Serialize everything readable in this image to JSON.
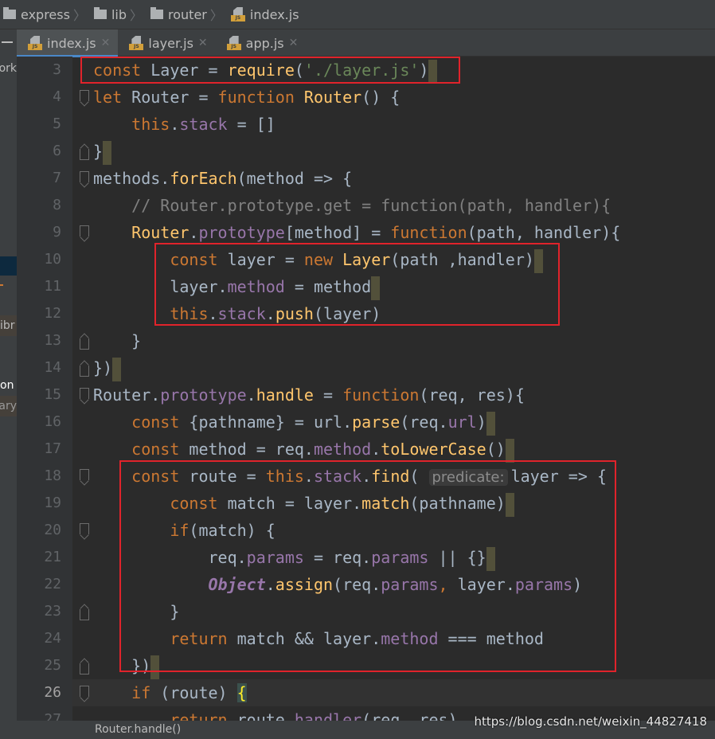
{
  "breadcrumb": [
    "express",
    "lib",
    "router",
    "index.js"
  ],
  "tabs": [
    {
      "label": "index.js",
      "active": true
    },
    {
      "label": "layer.js",
      "active": false
    },
    {
      "label": "app.js",
      "active": false
    }
  ],
  "left_panel_fragments": [
    "ork",
    "ibr",
    "on",
    "ary"
  ],
  "code_lines": [
    {
      "n": 3,
      "tokens": [
        [
          "const ",
          "kw"
        ],
        [
          "Layer = ",
          ""
        ],
        [
          "require",
          "fn"
        ],
        [
          "(",
          ""
        ],
        [
          "'./layer.js'",
          "st"
        ],
        [
          ")",
          ""
        ]
      ],
      "eol": true
    },
    {
      "n": 4,
      "fold": "start",
      "tokens": [
        [
          "let ",
          "kw"
        ],
        [
          "Router = ",
          ""
        ],
        [
          "function ",
          "kw"
        ],
        [
          "Router",
          "fn"
        ],
        [
          "() {",
          ""
        ]
      ]
    },
    {
      "n": 5,
      "tokens": [
        [
          "    ",
          ""
        ],
        [
          "this",
          "kw"
        ],
        [
          ".",
          ""
        ],
        [
          "stack",
          "pr"
        ],
        [
          " = []",
          ""
        ]
      ]
    },
    {
      "n": 6,
      "fold": "end",
      "tokens": [
        [
          "}",
          ""
        ]
      ],
      "eol": true
    },
    {
      "n": 7,
      "fold": "start",
      "tokens": [
        [
          "methods",
          ""
        ],
        [
          ".",
          ""
        ],
        [
          "forEach",
          "fn"
        ],
        [
          "(method => {",
          ""
        ]
      ]
    },
    {
      "n": 8,
      "tokens": [
        [
          "    // Router.prototype.get = function(path, handler){",
          "cm"
        ]
      ]
    },
    {
      "n": 9,
      "fold": "start",
      "tokens": [
        [
          "    ",
          ""
        ],
        [
          "Router",
          "fn"
        ],
        [
          ".",
          ""
        ],
        [
          "prototype",
          "pr"
        ],
        [
          "[method] = ",
          ""
        ],
        [
          "function",
          "kw"
        ],
        [
          "(path, handler){",
          ""
        ]
      ]
    },
    {
      "n": 10,
      "tokens": [
        [
          "        ",
          ""
        ],
        [
          "const ",
          "kw"
        ],
        [
          "layer = ",
          ""
        ],
        [
          "new ",
          "kw"
        ],
        [
          "Layer",
          "fn"
        ],
        [
          "(path ,handler)",
          ""
        ]
      ],
      "eol": true
    },
    {
      "n": 11,
      "tokens": [
        [
          "        layer.",
          ""
        ],
        [
          "method",
          "pr"
        ],
        [
          " = method",
          ""
        ]
      ],
      "eol": true
    },
    {
      "n": 12,
      "tokens": [
        [
          "        ",
          ""
        ],
        [
          "this",
          "kw"
        ],
        [
          ".",
          ""
        ],
        [
          "stack",
          "pr"
        ],
        [
          ".",
          ""
        ],
        [
          "push",
          "fn"
        ],
        [
          "(layer)",
          ""
        ]
      ]
    },
    {
      "n": 13,
      "fold": "end",
      "tokens": [
        [
          "    }",
          ""
        ]
      ]
    },
    {
      "n": 14,
      "fold": "end",
      "tokens": [
        [
          "})",
          ""
        ]
      ],
      "eol": true
    },
    {
      "n": 15,
      "fold": "start",
      "tokens": [
        [
          "Router",
          ""
        ],
        [
          ".",
          ""
        ],
        [
          "prototype",
          "pr"
        ],
        [
          ".",
          ""
        ],
        [
          "handle",
          "fn"
        ],
        [
          " = ",
          ""
        ],
        [
          "function",
          "kw"
        ],
        [
          "(req, res){",
          ""
        ]
      ]
    },
    {
      "n": 16,
      "tokens": [
        [
          "    ",
          ""
        ],
        [
          "const ",
          "kw"
        ],
        [
          "{pathname} = url.",
          ""
        ],
        [
          "parse",
          "fn"
        ],
        [
          "(req.",
          ""
        ],
        [
          "url",
          "pr"
        ],
        [
          ")",
          ""
        ]
      ],
      "eol": true
    },
    {
      "n": 17,
      "tokens": [
        [
          "    ",
          ""
        ],
        [
          "const ",
          "kw"
        ],
        [
          "method = req.",
          ""
        ],
        [
          "method",
          "pr"
        ],
        [
          ".",
          ""
        ],
        [
          "toLowerCase",
          "fn"
        ],
        [
          "()",
          ""
        ]
      ],
      "eol": true
    },
    {
      "n": 18,
      "fold": "start",
      "tokens": [
        [
          "    ",
          ""
        ],
        [
          "const ",
          "kw"
        ],
        [
          "route = ",
          ""
        ],
        [
          "this",
          "kw"
        ],
        [
          ".",
          ""
        ],
        [
          "stack",
          "pr"
        ],
        [
          ".",
          ""
        ],
        [
          "find",
          "fn"
        ],
        [
          "( ",
          ""
        ],
        [
          "predicate:",
          "hint"
        ],
        [
          "layer => {",
          ""
        ]
      ]
    },
    {
      "n": 19,
      "tokens": [
        [
          "        ",
          ""
        ],
        [
          "const ",
          "kw"
        ],
        [
          "match = layer.",
          ""
        ],
        [
          "match",
          "fn"
        ],
        [
          "(pathname)",
          ""
        ]
      ],
      "eol": true
    },
    {
      "n": 20,
      "fold": "start",
      "tokens": [
        [
          "        ",
          ""
        ],
        [
          "if",
          "kw"
        ],
        [
          "(match) {",
          ""
        ]
      ]
    },
    {
      "n": 21,
      "tokens": [
        [
          "            req.",
          ""
        ],
        [
          "params",
          "pr"
        ],
        [
          " = req.",
          ""
        ],
        [
          "params",
          "pr"
        ],
        [
          " || {}",
          ""
        ]
      ],
      "eol": true
    },
    {
      "n": 22,
      "tokens": [
        [
          "            ",
          ""
        ],
        [
          "Object",
          "ob"
        ],
        [
          ".",
          ""
        ],
        [
          "assign",
          "fn"
        ],
        [
          "(req.",
          ""
        ],
        [
          "params",
          "pr"
        ],
        [
          ", ",
          "kw"
        ],
        [
          "layer.",
          ""
        ],
        [
          "params",
          "pr"
        ],
        [
          ")",
          ""
        ]
      ]
    },
    {
      "n": 23,
      "fold": "end",
      "tokens": [
        [
          "        }",
          ""
        ]
      ]
    },
    {
      "n": 24,
      "tokens": [
        [
          "        ",
          ""
        ],
        [
          "return ",
          "kw"
        ],
        [
          "match && layer.",
          ""
        ],
        [
          "method",
          "pr"
        ],
        [
          " === method",
          ""
        ]
      ]
    },
    {
      "n": 25,
      "fold": "end",
      "tokens": [
        [
          "    })",
          ""
        ]
      ],
      "eol": true
    },
    {
      "n": 26,
      "fold": "start",
      "current": true,
      "tokens": [
        [
          "    ",
          ""
        ],
        [
          "if ",
          "kw"
        ],
        [
          "(route) ",
          ""
        ],
        [
          "{",
          "br"
        ]
      ]
    },
    {
      "n": 27,
      "tokens": [
        [
          "        ",
          ""
        ],
        [
          "return ",
          "kw"
        ],
        [
          "route.",
          ""
        ],
        [
          "handler",
          "pr"
        ],
        [
          "(req, res)",
          ""
        ]
      ]
    }
  ],
  "status": {
    "crumb": "Router.handle()"
  },
  "watermark": "https://blog.csdn.net/weixin_44827418",
  "colors": {
    "background": "#2b2b2b",
    "keyword": "#cc7832",
    "function": "#ffc66d",
    "property": "#9876aa",
    "string": "#6a8759",
    "comment": "#808080",
    "annotation_box": "#e0232b"
  }
}
